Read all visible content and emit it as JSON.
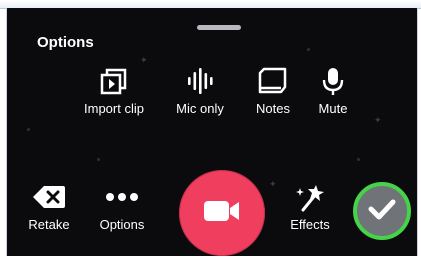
{
  "panel": {
    "title": "Options"
  },
  "options_row": [
    {
      "label": "Import clip",
      "icon": "import-clip-icon"
    },
    {
      "label": "Mic only",
      "icon": "waveform-icon"
    },
    {
      "label": "Notes",
      "icon": "notes-icon"
    },
    {
      "label": "Mute",
      "icon": "microphone-icon"
    }
  ],
  "bottom_bar": {
    "retake_label": "Retake",
    "options_label": "Options",
    "effects_label": "Effects",
    "record_icon": "video-camera-icon",
    "done_icon": "checkmark-icon"
  },
  "colors": {
    "background": "#0b0b0e",
    "record": "#ef3e5e",
    "done_fill": "#707377",
    "done_ring": "#45d347",
    "text": "#ffffff"
  }
}
